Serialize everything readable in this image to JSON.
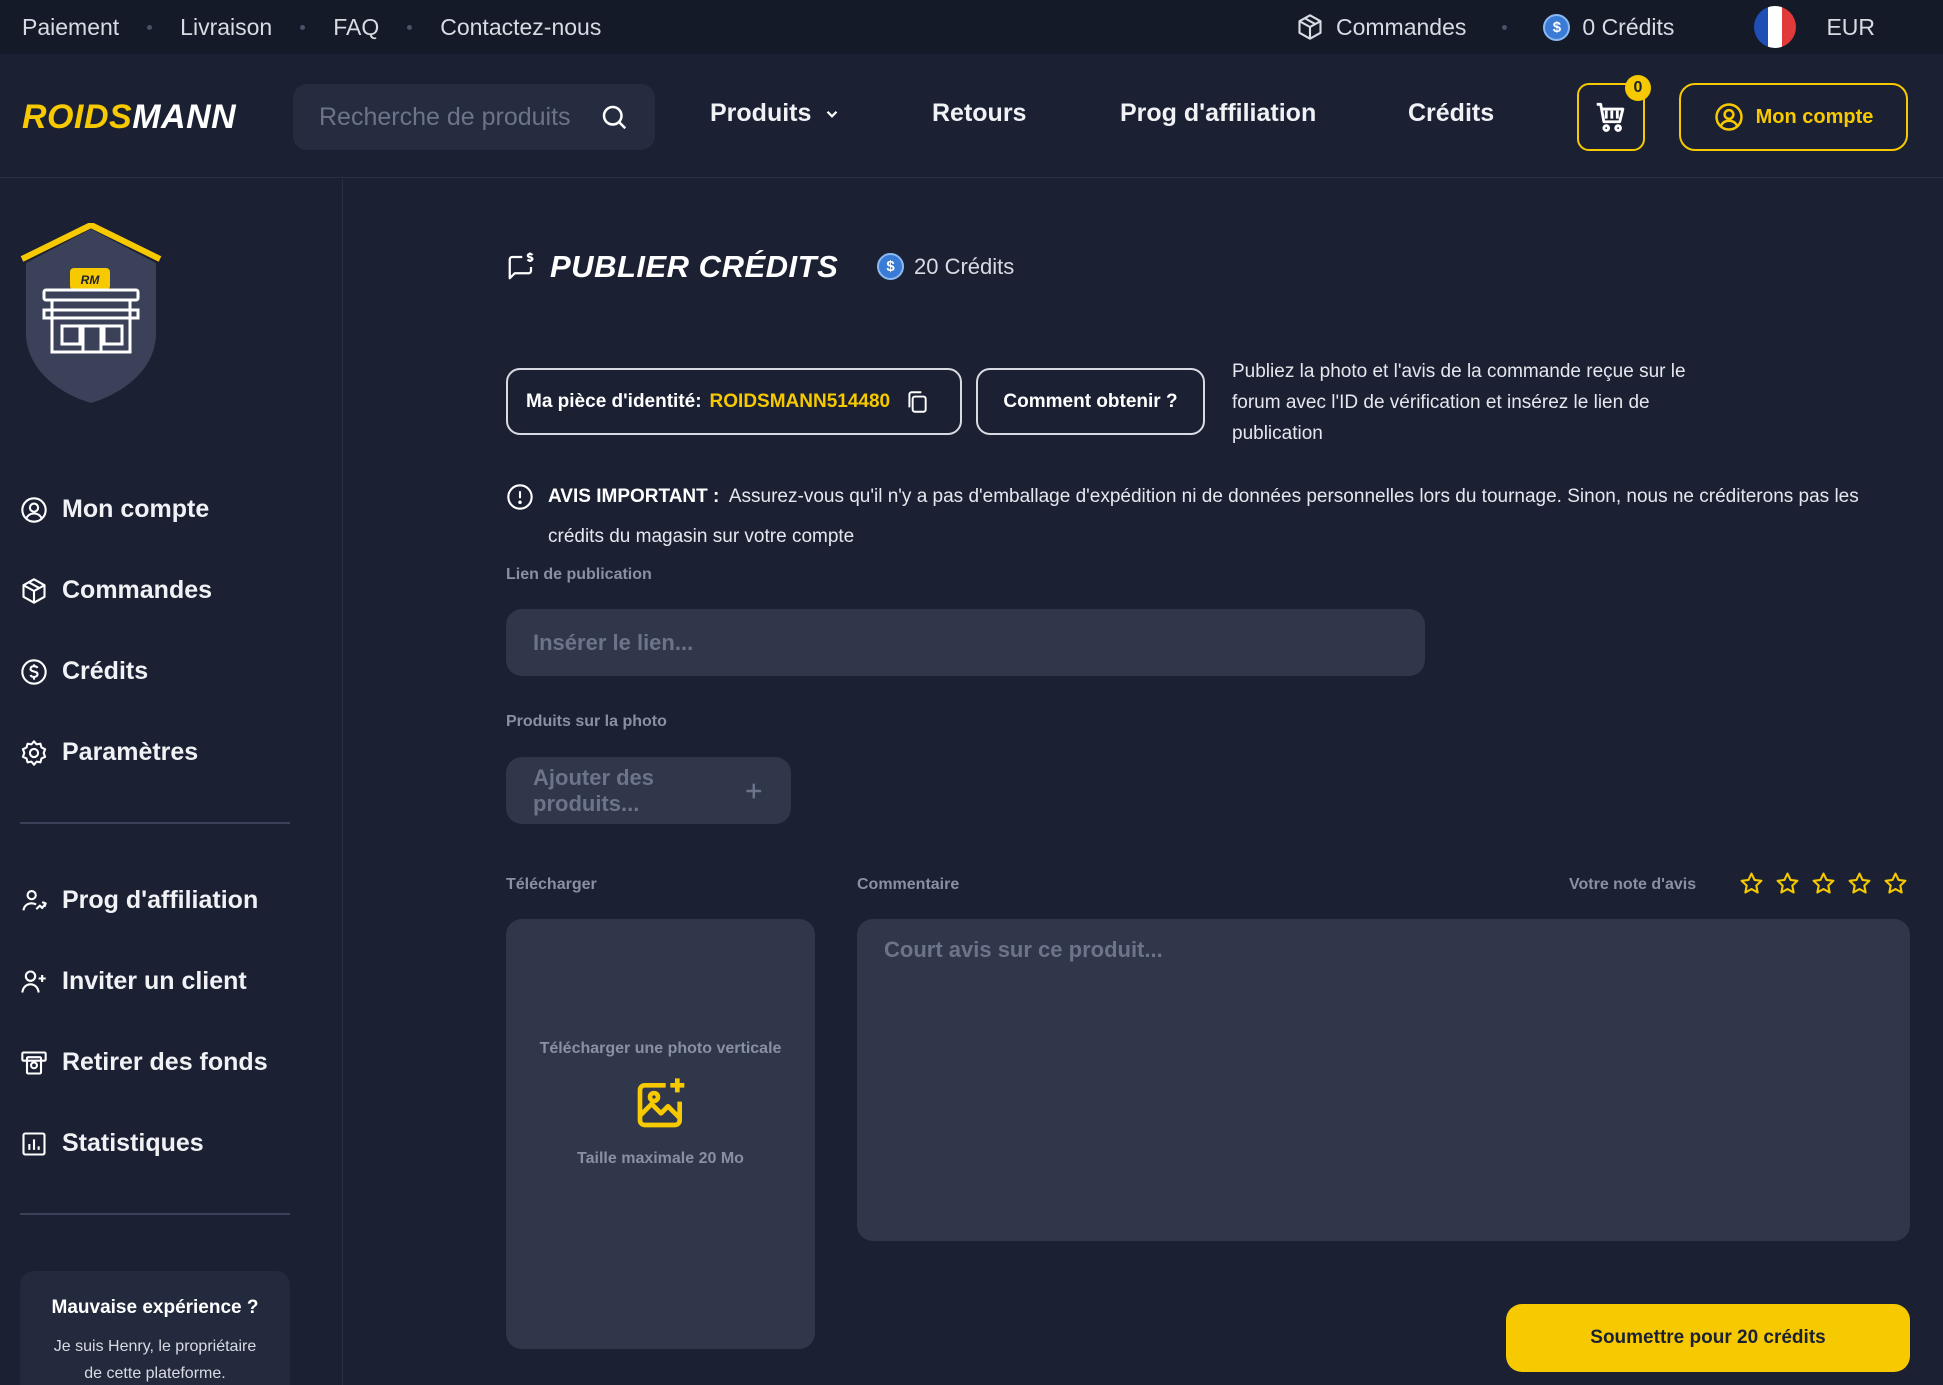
{
  "topbar": {
    "links": [
      "Paiement",
      "Livraison",
      "FAQ",
      "Contactez-nous"
    ],
    "orders_label": "Commandes",
    "credits_label": "0 Crédits",
    "currency": "EUR"
  },
  "header": {
    "logo_part1": "ROIDS",
    "logo_part2": "MANN",
    "search_placeholder": "Recherche de produits",
    "nav": {
      "products": "Produits",
      "returns": "Retours",
      "affiliate": "Prog d'affiliation",
      "credits": "Crédits"
    },
    "cart_count": "0",
    "account_label": "Mon compte"
  },
  "sidebar": {
    "shield_badge": "RM",
    "items": [
      {
        "label": "Mon compte",
        "icon": "user-circle-icon"
      },
      {
        "label": "Commandes",
        "icon": "box-icon"
      },
      {
        "label": "Crédits",
        "icon": "coin-icon"
      },
      {
        "label": "Paramètres",
        "icon": "gear-icon"
      },
      {
        "label": "Prog d'affiliation",
        "icon": "affiliate-icon"
      },
      {
        "label": "Inviter un client",
        "icon": "user-plus-icon"
      },
      {
        "label": "Retirer des fonds",
        "icon": "withdraw-icon"
      },
      {
        "label": "Statistiques",
        "icon": "stats-icon"
      }
    ],
    "help": {
      "title": "Mauvaise expérience ?",
      "line1": "Je suis Henry, le propriétaire",
      "line2": "de cette plateforme."
    }
  },
  "main": {
    "title": "PUBLIER CRÉDITS",
    "title_credits": "20 Crédits",
    "id_label": "Ma pièce d'identité:",
    "id_value": "ROIDSMANN514480",
    "how_button": "Comment obtenir ?",
    "how_text": "Publiez la photo et l'avis de la commande reçue sur le forum avec l'ID de vérification et insérez le lien de publication",
    "notice_label": "AVIS IMPORTANT :",
    "notice_text": "Assurez-vous qu'il n'y a pas d'emballage d'expédition ni de données personnelles lors du tournage. Sinon, nous ne créditerons pas les crédits du magasin sur votre compte",
    "link_label": "Lien de publication",
    "link_placeholder": "Insérer le lien...",
    "products_label": "Produits sur la photo",
    "products_placeholder": "Ajouter des produits...",
    "upload_label": "Télécharger",
    "upload_title": "Télécharger une photo verticale",
    "upload_size": "Taille maximale 20 Mo",
    "comment_label": "Commentaire",
    "comment_placeholder": "Court avis sur ce produit...",
    "rating_label": "Votre note d'avis",
    "rating_value": 0,
    "rating_max": 5,
    "submit_label": "Soumettre pour 20 crédits"
  },
  "colors": {
    "accent": "#f6c900",
    "background": "#1b2133",
    "field": "#30374b",
    "coin": "#3a7bd5"
  }
}
